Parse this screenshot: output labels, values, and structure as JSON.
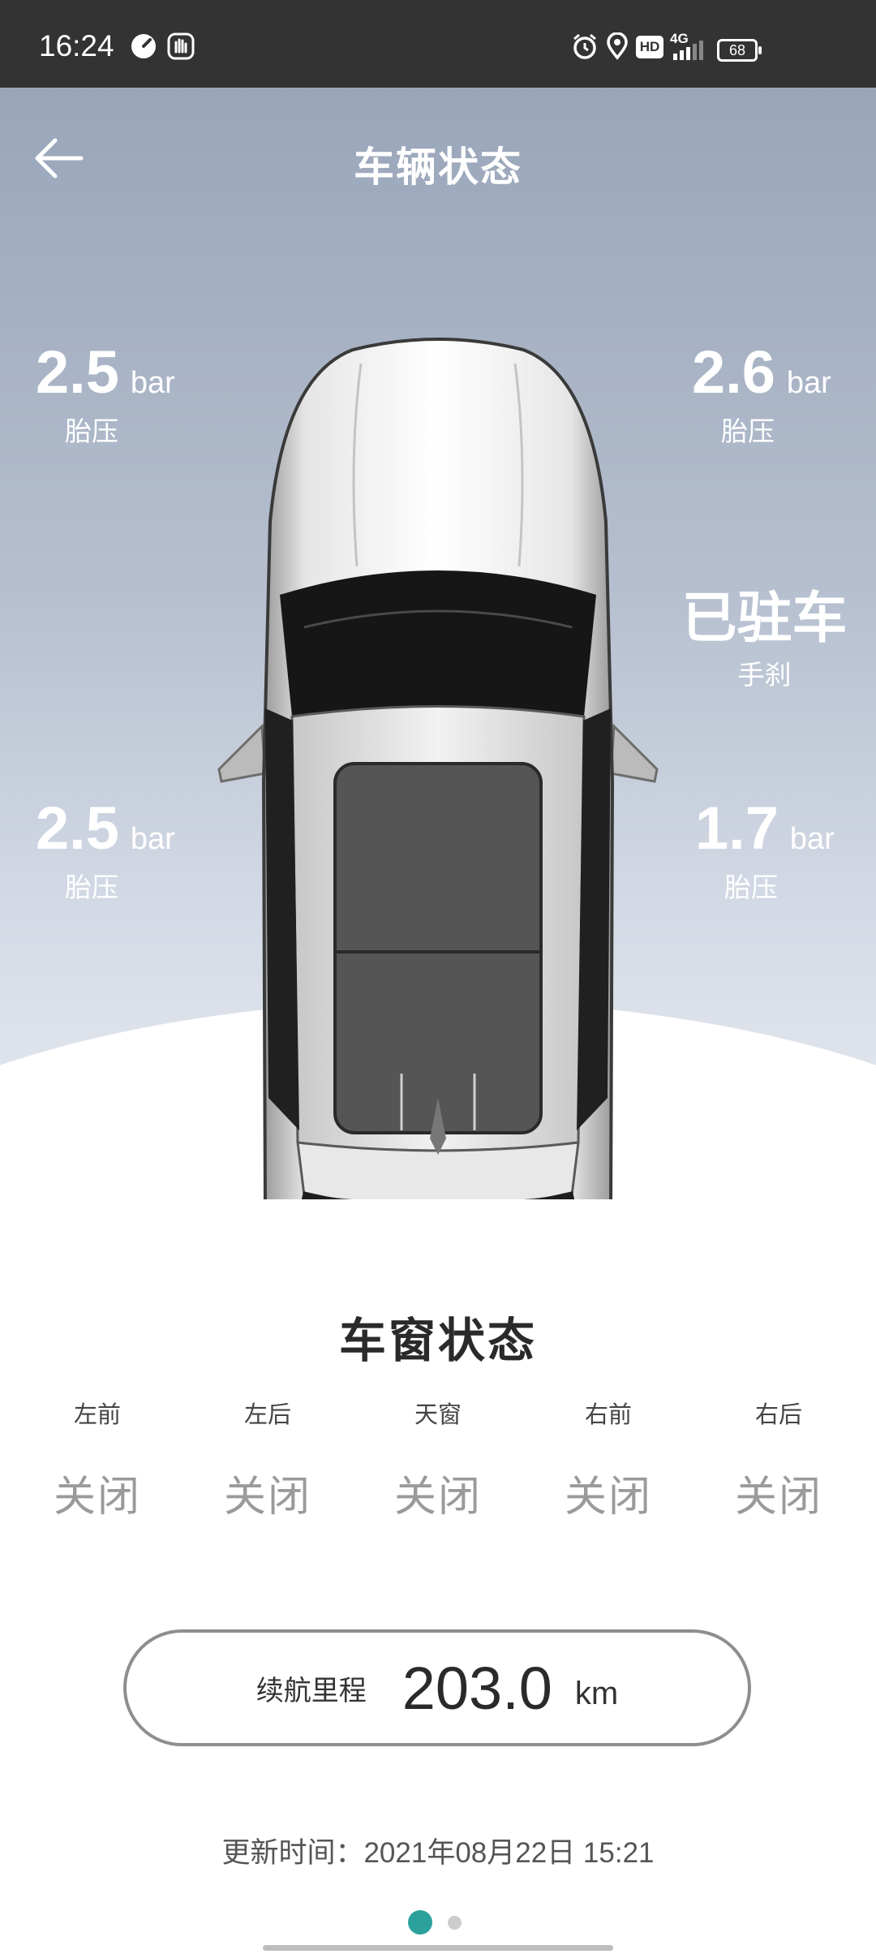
{
  "status_bar": {
    "time": "16:24",
    "battery": "68",
    "network": "4G",
    "hd": "HD",
    "icons": [
      "speedometer-icon",
      "hand-icon",
      "alarm-icon",
      "location-icon",
      "hd-icon",
      "signal-icon",
      "battery-icon"
    ]
  },
  "header": {
    "title": "车辆状态",
    "back_icon": "arrow-left-icon"
  },
  "tires": {
    "front_left": {
      "value": "2.5",
      "unit": "bar",
      "label": "胎压"
    },
    "front_right": {
      "value": "2.6",
      "unit": "bar",
      "label": "胎压"
    },
    "rear_left": {
      "value": "2.5",
      "unit": "bar",
      "label": "胎压"
    },
    "rear_right": {
      "value": "1.7",
      "unit": "bar",
      "label": "胎压"
    }
  },
  "parking": {
    "status": "已驻车",
    "label": "手刹"
  },
  "windows": {
    "title": "车窗状态",
    "items": [
      {
        "label": "左前",
        "state": "关闭"
      },
      {
        "label": "左后",
        "state": "关闭"
      },
      {
        "label": "天窗",
        "state": "关闭"
      },
      {
        "label": "右前",
        "state": "关闭"
      },
      {
        "label": "右后",
        "state": "关闭"
      }
    ]
  },
  "range": {
    "label": "续航里程",
    "value": "203.0",
    "unit": "km"
  },
  "update": {
    "text": "更新时间：2021年08月22日 15:21"
  },
  "pager": {
    "current": 1,
    "total": 2,
    "active_color": "#2ca19c"
  },
  "colors": {
    "status_bar": "#333333",
    "hero_top": "#99a5b9",
    "hero_bottom": "#e8ebf1"
  }
}
